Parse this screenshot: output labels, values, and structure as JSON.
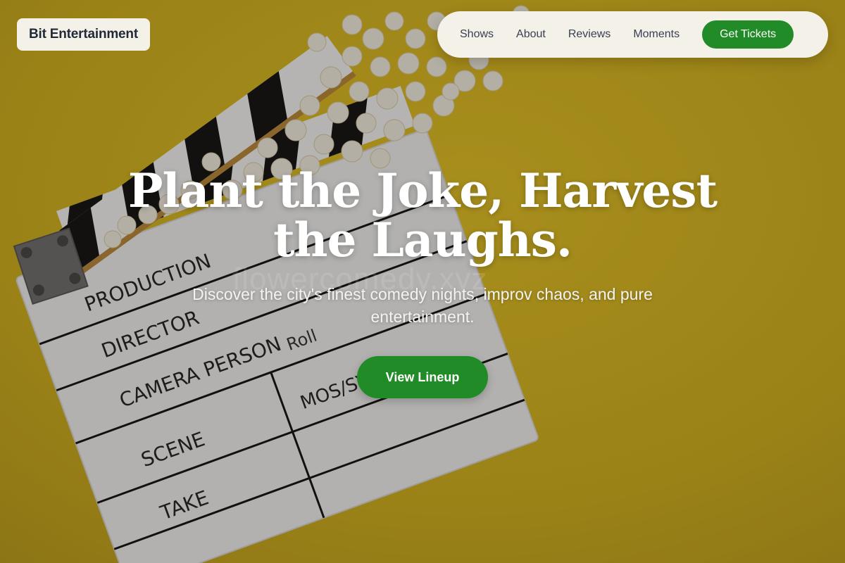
{
  "brand": {
    "name": "Bit Entertainment"
  },
  "nav": {
    "links": [
      "Shows",
      "About",
      "Reviews",
      "Moments"
    ],
    "cta_label": "Get Tickets"
  },
  "hero": {
    "headline_line1": "Plant the Joke, Harvest",
    "headline_line2": "the Laughs.",
    "subheadline": "Discover the city's finest comedy nights, improv chaos, and pure entertainment.",
    "cta_label": "View Lineup",
    "watermark": "flowercomedy.xyz"
  },
  "clapperboard": {
    "fields": [
      "PRODUCTION",
      "DIRECTOR",
      "CAMERA PERSON",
      "Roll",
      "SCENE",
      "MOS/SYNC",
      "TAKE"
    ]
  },
  "colors": {
    "accent_green": "#218b27",
    "background_yellow": "#c9a81b",
    "pill_bg": "#f4f1e8",
    "text_dark": "#1f2937"
  }
}
